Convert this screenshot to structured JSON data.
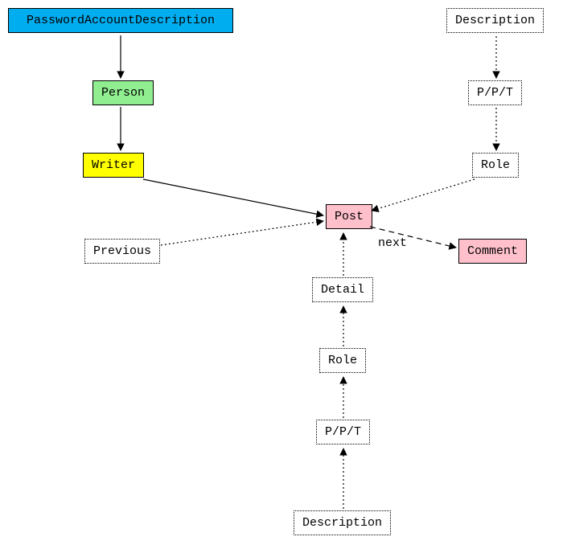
{
  "nodes": {
    "pad": "PasswordAccountDescription",
    "person": "Person",
    "writer": "Writer",
    "post": "Post",
    "comment": "Comment",
    "previous": "Previous",
    "detail": "Detail",
    "role_b": "Role",
    "ppt_b": "P/P/T",
    "desc_b": "Description",
    "desc_t": "Description",
    "ppt_t": "P/P/T",
    "role_t": "Role"
  },
  "edges": {
    "next": "next"
  },
  "chart_data": {
    "type": "graph",
    "nodes": [
      {
        "id": "PasswordAccountDescription",
        "style": "solid",
        "fill": "#00aef0"
      },
      {
        "id": "Person",
        "style": "solid",
        "fill": "#90ee90"
      },
      {
        "id": "Writer",
        "style": "solid",
        "fill": "#ffff00"
      },
      {
        "id": "Post",
        "style": "solid",
        "fill": "#ffc0cb"
      },
      {
        "id": "Comment",
        "style": "solid",
        "fill": "#ffc0cb"
      },
      {
        "id": "Previous",
        "style": "dotted"
      },
      {
        "id": "Detail",
        "style": "dotted"
      },
      {
        "id": "Role_bottom",
        "label": "Role",
        "style": "dotted"
      },
      {
        "id": "PPT_bottom",
        "label": "P/P/T",
        "style": "dotted"
      },
      {
        "id": "Description_bottom",
        "label": "Description",
        "style": "dotted"
      },
      {
        "id": "Description_top",
        "label": "Description",
        "style": "dotted"
      },
      {
        "id": "PPT_top",
        "label": "P/P/T",
        "style": "dotted"
      },
      {
        "id": "Role_top",
        "label": "Role",
        "style": "dotted"
      }
    ],
    "edges": [
      {
        "from": "PasswordAccountDescription",
        "to": "Person",
        "style": "solid"
      },
      {
        "from": "Person",
        "to": "Writer",
        "style": "solid"
      },
      {
        "from": "Writer",
        "to": "Post",
        "style": "solid"
      },
      {
        "from": "Post",
        "to": "Comment",
        "style": "dashed",
        "label": "next"
      },
      {
        "from": "Previous",
        "to": "Post",
        "style": "dotted"
      },
      {
        "from": "Detail",
        "to": "Post",
        "style": "dotted"
      },
      {
        "from": "Role_bottom",
        "to": "Detail",
        "style": "dotted"
      },
      {
        "from": "PPT_bottom",
        "to": "Role_bottom",
        "style": "dotted"
      },
      {
        "from": "Description_bottom",
        "to": "PPT_bottom",
        "style": "dotted"
      },
      {
        "from": "Description_top",
        "to": "PPT_top",
        "style": "dotted"
      },
      {
        "from": "PPT_top",
        "to": "Role_top",
        "style": "dotted"
      },
      {
        "from": "Role_top",
        "to": "Post",
        "style": "dotted"
      }
    ]
  }
}
